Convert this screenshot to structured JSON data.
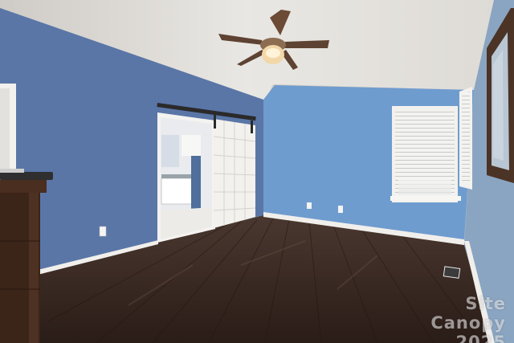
{
  "scene": {
    "description_colors": {
      "ceiling": "#d6d3cf",
      "wall_left": "#5b77a8",
      "wall_back": "#6e9bcf",
      "wall_right": "#8aa7c4",
      "floor": "#3a2a24",
      "trim": "#f4f2ee",
      "door": "#f2f0ec",
      "dresser": "#3b2418"
    }
  },
  "watermark": {
    "text": "Site\nCanopy\n2025"
  }
}
